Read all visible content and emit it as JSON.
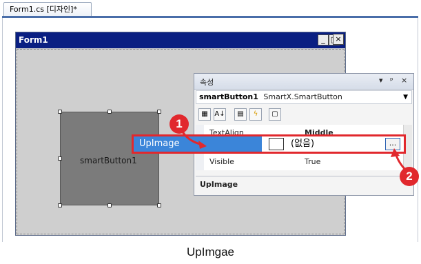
{
  "document_tab": {
    "label": "Form1.cs [디자인]*"
  },
  "form": {
    "title": "Form1",
    "minimize": "_",
    "maximize": "□",
    "close": "×"
  },
  "smart_button": {
    "label": "smartButton1"
  },
  "properties": {
    "title": "속성",
    "header_icons": [
      "▾",
      "ᵖ",
      "×"
    ],
    "object_name": "smartButton1",
    "object_type": "SmartX.SmartButton",
    "toolbar_icons": [
      "categorized-icon",
      "alphabetical-icon",
      "properties-icon",
      "events-icon",
      "property-pages-icon"
    ],
    "toolbar_glyphs": [
      "▦",
      "A↓",
      "▤",
      "ϟ",
      "▢"
    ],
    "rows": [
      {
        "name": "TextAlign",
        "value": "Middle"
      },
      {
        "name": "Visible",
        "value": "True"
      }
    ],
    "description_title": "UpImage"
  },
  "callout": {
    "property_name": "UpImage",
    "value": "(없음)",
    "ellipsis": "..."
  },
  "badges": {
    "step1": "1",
    "step2": "2"
  },
  "caption": "UpImgae",
  "colors": {
    "form_titlebar": "#0a1f82",
    "selection_blue": "#3b85d9",
    "highlight_red": "#e1282d"
  }
}
